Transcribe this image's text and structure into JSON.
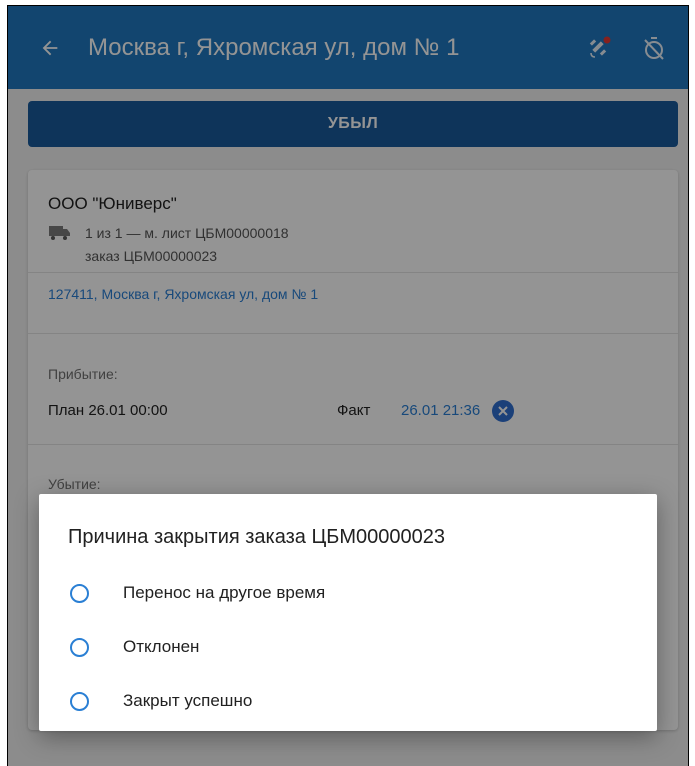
{
  "header": {
    "title": "Москва г, Яхромская ул, дом № 1",
    "back_icon": "arrow-left-icon",
    "gps_icon": "satellite-icon",
    "timer_icon": "timer-off-icon"
  },
  "actions": {
    "depart_label": "УБЫЛ"
  },
  "stop_card": {
    "company": "ООО \"Юниверс\"",
    "route": "1 из 1 — м. лист ЦБМ00000018",
    "order": "заказ ЦБМ00000023",
    "address": "127411, Москва г, Яхромская ул, дом № 1",
    "arrival_label": "Прибытие:",
    "plan_text": "План  26.01 00:00",
    "fact_label": "Факт",
    "fact_value": "26.01 21:36",
    "departure_label": "Убытие:"
  },
  "dialog": {
    "title": "Причина закрытия заказа ЦБМ00000023",
    "options": [
      {
        "label": "Перенос на другое время"
      },
      {
        "label": "Отклонен"
      },
      {
        "label": "Закрыт успешно"
      }
    ]
  },
  "colors": {
    "app_bar": "#1f78bf",
    "depart_button": "#195b9b",
    "link": "#2a7fd4",
    "accent": "#2f6fd0",
    "gps_dot": "#e53935"
  }
}
